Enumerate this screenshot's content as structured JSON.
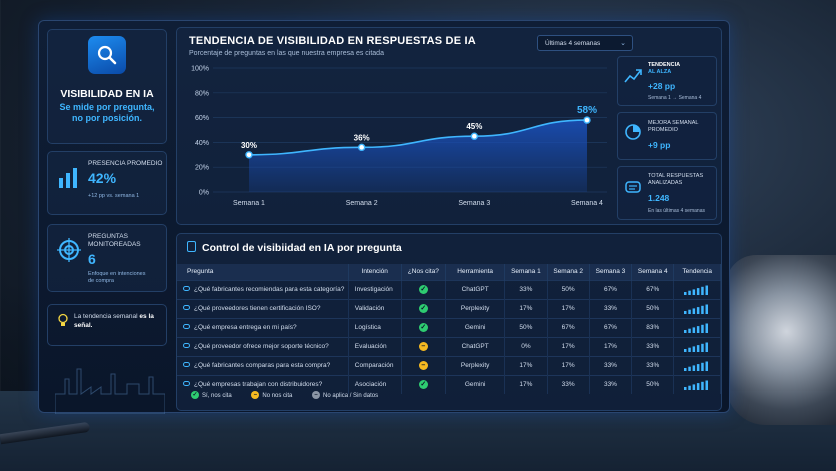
{
  "sidebar": {
    "title": "VISIBILIDAD EN IA",
    "subtitle_line1": "Se mide por pregunta,",
    "subtitle_line2": "no por posición.",
    "presence": {
      "label": "PRESENCIA PROMEDIO",
      "value": "42%",
      "sub": "+12 pp vs. semana 1"
    },
    "monitored": {
      "label_line1": "PREGUNTAS",
      "label_line2": "MONITOREADAS",
      "value": "6",
      "sub_line1": "Enfoque en intenciones",
      "sub_line2": "de compra"
    },
    "note": {
      "text": "La tendencia semanal",
      "bold": "es la señal."
    }
  },
  "chart_panel": {
    "title": "TENDENCIA DE VISIBILIDAD EN RESPUESTAS DE IA",
    "subtitle": "Porcentaje de preguntas en las que nuestra empresa es citada",
    "period": "Últimas 4 semanas"
  },
  "chart_data": {
    "type": "area",
    "categories": [
      "Semana 1",
      "Semana 2",
      "Semana 3",
      "Semana 4"
    ],
    "values": [
      30,
      36,
      45,
      58
    ],
    "value_labels": [
      "30%",
      "36%",
      "45%",
      "58%"
    ],
    "yticks": [
      "0%",
      "20%",
      "40%",
      "60%",
      "80%",
      "100%"
    ],
    "ylim": [
      0,
      100
    ],
    "grid": true,
    "colors": {
      "line": "#3fb6ff",
      "area": "#1a4fb8",
      "highlight": "#3fb6ff"
    }
  },
  "stats": [
    {
      "label_line1": "TENDENCIA",
      "label_line2": "AL ALZA",
      "value": "+28 pp",
      "sub": "Semana 1 → Semana 4",
      "icon": "trend-up-icon"
    },
    {
      "label_line1": "MEJORA SEMANAL",
      "label_line2": "PROMEDIO",
      "value": "+9 pp",
      "sub": "",
      "icon": "pie-icon"
    },
    {
      "label_line1": "TOTAL RESPUESTAS",
      "label_line2": "ANALIZADAS",
      "value": "1.248",
      "sub": "En las últimas 4 semanas",
      "icon": "chat-icon"
    }
  ],
  "table": {
    "title": "Control de visibiidad en IA por pregunta",
    "headers": [
      "Pregunta",
      "Intención",
      "¿Nos cita?",
      "Herramienta",
      "Semana 1",
      "Semana 2",
      "Semana 3",
      "Semana 4",
      "Tendencia"
    ],
    "rows": [
      {
        "q": "¿Qué fabricantes recomiendas para esta categoría?",
        "intent": "Investigación",
        "cite": "yes",
        "tool": "ChatGPT",
        "w": [
          "33%",
          "50%",
          "67%",
          "67%"
        ]
      },
      {
        "q": "¿Qué proveedores tienen certificación ISO?",
        "intent": "Validación",
        "cite": "yes",
        "tool": "Perplexity",
        "w": [
          "17%",
          "17%",
          "33%",
          "50%"
        ]
      },
      {
        "q": "¿Qué empresa entrega en mi país?",
        "intent": "Logística",
        "cite": "yes",
        "tool": "Gemini",
        "w": [
          "50%",
          "67%",
          "67%",
          "83%"
        ]
      },
      {
        "q": "¿Qué proveedor ofrece mejor soporte técnico?",
        "intent": "Evaluación",
        "cite": "no",
        "tool": "ChatGPT",
        "w": [
          "0%",
          "17%",
          "17%",
          "33%"
        ]
      },
      {
        "q": "¿Qué fabricantes comparas para esta compra?",
        "intent": "Comparación",
        "cite": "no",
        "tool": "Perplexity",
        "w": [
          "17%",
          "17%",
          "33%",
          "33%"
        ]
      },
      {
        "q": "¿Qué empresas trabajan con distribuidores?",
        "intent": "Asociación",
        "cite": "yes",
        "tool": "Gemini",
        "w": [
          "17%",
          "33%",
          "33%",
          "50%"
        ]
      }
    ],
    "legend": {
      "yes": "Sí, nos cita",
      "no": "No nos cita",
      "na": "No aplica / Sin datos"
    },
    "status_colors": {
      "yes": "#2ecc71",
      "no": "#f5b921",
      "na": "#8a95a5"
    }
  }
}
